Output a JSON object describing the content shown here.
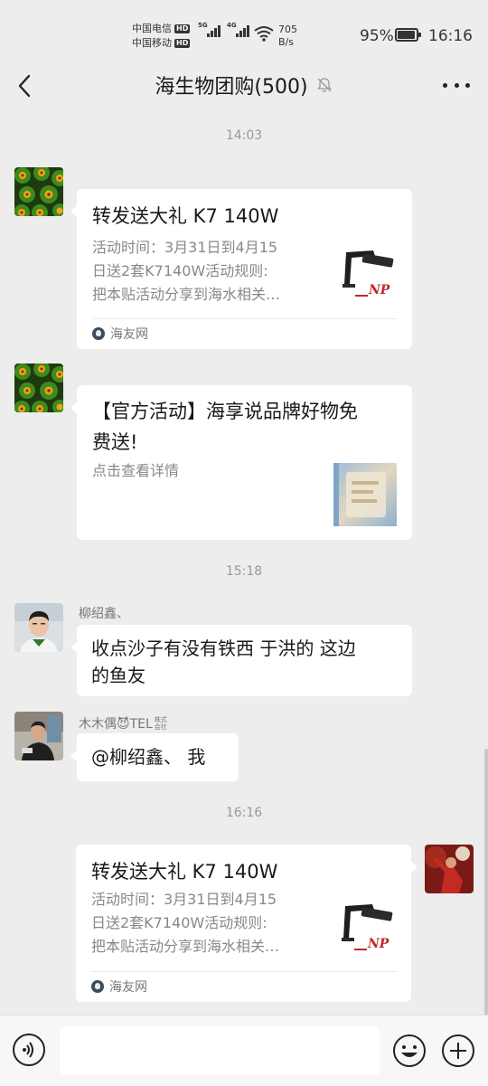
{
  "status_bar": {
    "carrier1": "中国电信",
    "carrier2": "中国移动",
    "hd_badge": "HD",
    "net1": "5G",
    "net2": "4G",
    "speed_value": "705",
    "speed_unit": "B/s",
    "battery_percent": "95%",
    "battery_level": 0.95,
    "time": "16:16"
  },
  "header": {
    "title": "海生物团购(500)"
  },
  "messages": {
    "ts1": "14:03",
    "card1": {
      "title": "转发送大礼 K7 140W",
      "desc1": "活动时间：3月31日到4月15",
      "desc2": "日送2套K7140W活动规则:",
      "desc3": "把本贴活动分享到海水相关…",
      "source": "海友网"
    },
    "card2": {
      "title1": "【官方活动】海享说品牌好物免",
      "title2": "费送!",
      "desc": "点击查看详情"
    },
    "ts2": "15:18",
    "msg3": {
      "sender": "柳绍鑫、",
      "line1": "收点沙子有没有铁西 于洪的 这边",
      "line2": "的鱼友"
    },
    "msg4": {
      "sender": "木木偶😈TEL",
      "sender_badge": "株式会社",
      "text": "@柳绍鑫、 我"
    },
    "ts3": "16:16",
    "card3": {
      "title": "转发送大礼 K7 140W",
      "desc1": "活动时间：3月31日到4月15",
      "desc2": "日送2套K7140W活动规则:",
      "desc3": "把本贴活动分享到海水相关…",
      "source": "海友网"
    }
  },
  "icons": {
    "back": "chevron-left-icon",
    "mute": "bell-off-icon",
    "more": "more-horizontal-icon",
    "voice": "voice-icon",
    "emoji": "emoji-icon",
    "plus": "plus-icon"
  },
  "colors": {
    "background": "#ededed",
    "bubble": "#ffffff",
    "timestamp": "#999999",
    "lamp_logo_red": "#c0262d"
  }
}
